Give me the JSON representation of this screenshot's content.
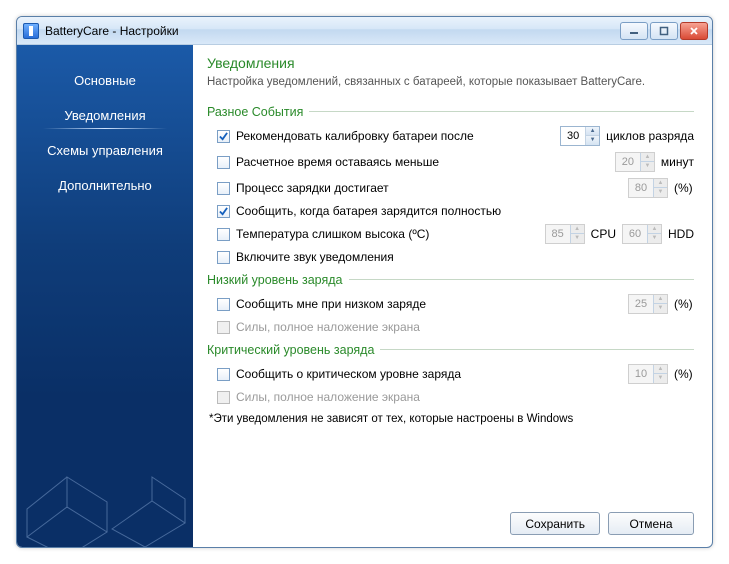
{
  "window": {
    "title": "BatteryCare - Настройки"
  },
  "sidebar": {
    "items": [
      {
        "label": "Основные"
      },
      {
        "label": "Уведомления"
      },
      {
        "label": "Схемы управления"
      },
      {
        "label": "Дополнительно"
      }
    ],
    "active_index": 1
  },
  "page": {
    "title": "Уведомления",
    "description": "Настройка уведомлений, связанных с батареей, которые показывает BatteryCare."
  },
  "groups": {
    "misc": {
      "head": "Разное События",
      "calibrate_label": "Рекомендовать калибровку батареи после",
      "calibrate_checked": true,
      "calibrate_value": "30",
      "calibrate_unit": "циклов разряда",
      "remain_label": "Расчетное время оставаясь меньше",
      "remain_checked": false,
      "remain_value": "20",
      "remain_unit": "минут",
      "charge_label": "Процесс зарядки достигает",
      "charge_checked": false,
      "charge_value": "80",
      "charge_unit": "(%)",
      "full_label": "Сообщить, когда батарея зарядится полностью",
      "full_checked": true,
      "temp_label": "Температура слишком высока (ºC)",
      "temp_checked": false,
      "temp_cpu_value": "85",
      "temp_cpu_unit": "CPU",
      "temp_hdd_value": "60",
      "temp_hdd_unit": "HDD",
      "sound_label": "Включите звук уведомления",
      "sound_checked": false
    },
    "low": {
      "head": "Низкий уровень заряда",
      "notify_label": "Сообщить мне при низком заряде",
      "notify_checked": false,
      "notify_value": "25",
      "notify_unit": "(%)",
      "overlay_label": "Силы, полное наложение экрана",
      "overlay_checked": false
    },
    "critical": {
      "head": "Критический уровень заряда",
      "notify_label": "Сообщить о критическом уровне заряда",
      "notify_checked": false,
      "notify_value": "10",
      "notify_unit": "(%)",
      "overlay_label": "Силы, полное наложение экрана",
      "overlay_checked": false
    }
  },
  "footnote": "*Эти уведомления не зависят от тех, которые настроены в Windows",
  "buttons": {
    "save": "Сохранить",
    "cancel": "Отмена"
  }
}
